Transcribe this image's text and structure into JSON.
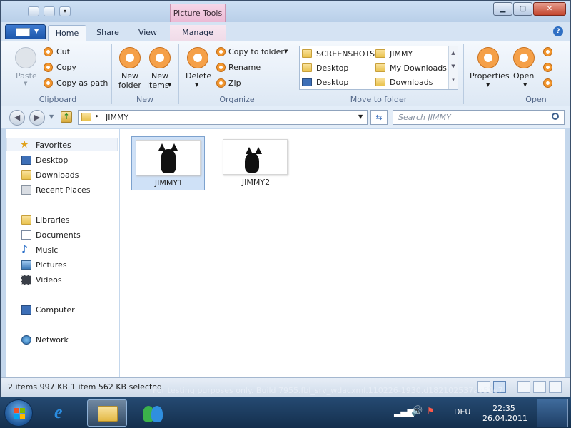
{
  "title_bar": {
    "context_tab": "Picture Tools"
  },
  "tabs": [
    "Home",
    "Share",
    "View",
    "Manage"
  ],
  "ribbon": {
    "clipboard": {
      "paste": "Paste",
      "cut": "Cut",
      "copy": "Copy",
      "copy_as_path": "Copy as path",
      "group": "Clipboard"
    },
    "new": {
      "new_folder_l1": "New",
      "new_folder_l2": "folder",
      "new_items_l1": "New",
      "new_items_l2": "items",
      "group": "New"
    },
    "organize": {
      "delete": "Delete",
      "copy_to_folder": "Copy to folder",
      "rename": "Rename",
      "zip": "Zip",
      "group": "Organize"
    },
    "move_to_folder": {
      "items": [
        "SCREENSHOTS",
        "JIMMY",
        "Desktop",
        "My Downloads",
        "Desktop",
        "Downloads"
      ],
      "group": "Move to folder"
    },
    "open": {
      "properties": "Properties",
      "open": "Open",
      "group": "Open"
    }
  },
  "navigation": {
    "path_label": "JIMMY",
    "search_placeholder": "Search JIMMY"
  },
  "sidebar": {
    "favorites": {
      "label": "Favorites",
      "items": [
        "Desktop",
        "Downloads",
        "Recent Places"
      ]
    },
    "libraries": {
      "label": "Libraries",
      "items": [
        "Documents",
        "Music",
        "Pictures",
        "Videos"
      ]
    },
    "computer": "Computer",
    "network": "Network"
  },
  "files": [
    {
      "name": "JIMMY1",
      "selected": true
    },
    {
      "name": "JIMMY2",
      "selected": false
    }
  ],
  "status_bar": {
    "item_count": "2 items 997 KB",
    "selection": "1 item 562 KB selected"
  },
  "taskbar": {
    "watermark": "For testing purposes only. Build 7955.fbl_srv_wdacxml.110226-1930.d182102537ad52e7",
    "language": "DEU",
    "time": "22:35",
    "date": "26.04.2011"
  },
  "icons": [
    "window-icon",
    "back-icon",
    "forward-icon",
    "refresh-icon",
    "search-icon",
    "star-icon",
    "folder-icon",
    "computer-icon",
    "network-icon",
    "windows-logo-icon",
    "ie-icon"
  ]
}
